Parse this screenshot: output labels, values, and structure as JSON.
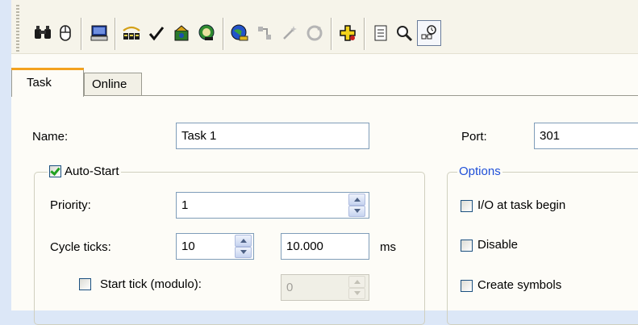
{
  "tabs": [
    {
      "label": "Task",
      "active": true
    },
    {
      "label": "Online",
      "active": false
    }
  ],
  "toolbar": {
    "icons": [
      "binoculars-icon",
      "mouse-icon",
      "computer-icon",
      "network-icon",
      "check-icon",
      "build-icon",
      "target-icon",
      "globe-icon",
      "link-disabled-icon",
      "wand-disabled-icon",
      "refresh-disabled-icon",
      "add-icon",
      "list-icon",
      "search-icon",
      "task-config-icon"
    ]
  },
  "form": {
    "name_label": "Name:",
    "name_value": "Task 1",
    "port_label": "Port:",
    "port_value": "301",
    "autostart": {
      "label": "Auto-Start",
      "checked": true
    },
    "priority_label": "Priority:",
    "priority_value": "1",
    "cycle_label": "Cycle ticks:",
    "cycle_ticks_value": "10",
    "cycle_ms_value": "10.000",
    "ms_unit": "ms",
    "start_tick": {
      "label": "Start tick (modulo):",
      "checked": false,
      "value": "0"
    },
    "options": {
      "title": "Options",
      "items": [
        {
          "label": "I/O at task begin",
          "checked": false
        },
        {
          "label": "Disable",
          "checked": false
        },
        {
          "label": "Create symbols",
          "checked": false
        }
      ]
    }
  },
  "colors": {
    "accent_tab": "#f3a21f",
    "options_title": "#1f4fd8",
    "window_bg": "#fdfcf7",
    "side_bg": "#dce7f7"
  }
}
